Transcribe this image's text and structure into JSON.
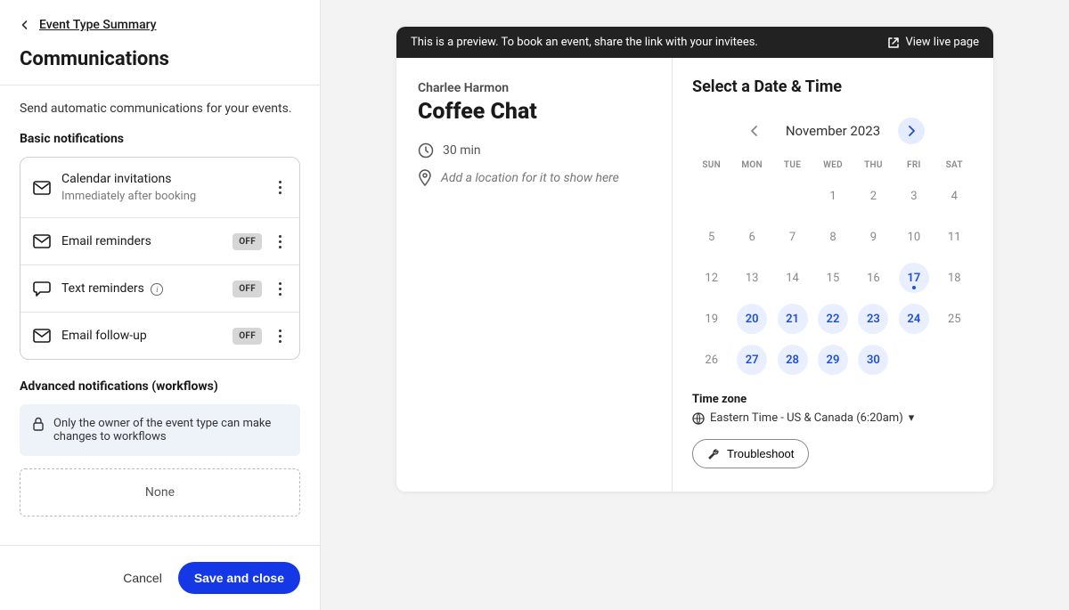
{
  "left": {
    "back_link": "Event Type Summary",
    "title": "Communications",
    "description": "Send automatic communications for your events.",
    "basic_title": "Basic notifications",
    "rows": {
      "calendar_invites": "Calendar invitations",
      "calendar_invites_sub": "Immediately after booking",
      "email_reminders": "Email reminders",
      "text_reminders": "Text reminders",
      "email_followup": "Email follow-up"
    },
    "off_badge": "OFF",
    "advanced_title": "Advanced notifications (workflows)",
    "advanced_banner": "Only the owner of the event type can make changes to workflows",
    "empty": "None",
    "cancel": "Cancel",
    "save": "Save and close"
  },
  "preview": {
    "banner_text": "This is a preview. To book an event, share the link with your invitees.",
    "view_live": "View live page",
    "host": "Charlee Harmon",
    "event_title": "Coffee Chat",
    "duration": "30 min",
    "location_placeholder": "Add a location for it to show here",
    "select_title": "Select a Date & Time",
    "month": "November 2023",
    "dow": [
      "SUN",
      "MON",
      "TUE",
      "WED",
      "THU",
      "FRI",
      "SAT"
    ],
    "days": [
      {
        "n": "",
        "t": "blank"
      },
      {
        "n": "",
        "t": "blank"
      },
      {
        "n": "",
        "t": "blank"
      },
      {
        "n": "1",
        "t": "off"
      },
      {
        "n": "2",
        "t": "off"
      },
      {
        "n": "3",
        "t": "off"
      },
      {
        "n": "4",
        "t": "off"
      },
      {
        "n": "5",
        "t": "off"
      },
      {
        "n": "6",
        "t": "off"
      },
      {
        "n": "7",
        "t": "off"
      },
      {
        "n": "8",
        "t": "off"
      },
      {
        "n": "9",
        "t": "off"
      },
      {
        "n": "10",
        "t": "off"
      },
      {
        "n": "11",
        "t": "off"
      },
      {
        "n": "12",
        "t": "off"
      },
      {
        "n": "13",
        "t": "off"
      },
      {
        "n": "14",
        "t": "off"
      },
      {
        "n": "15",
        "t": "off"
      },
      {
        "n": "16",
        "t": "off"
      },
      {
        "n": "17",
        "t": "avail today"
      },
      {
        "n": "18",
        "t": "off"
      },
      {
        "n": "19",
        "t": "off"
      },
      {
        "n": "20",
        "t": "avail"
      },
      {
        "n": "21",
        "t": "avail"
      },
      {
        "n": "22",
        "t": "avail"
      },
      {
        "n": "23",
        "t": "avail"
      },
      {
        "n": "24",
        "t": "avail"
      },
      {
        "n": "25",
        "t": "off"
      },
      {
        "n": "26",
        "t": "off"
      },
      {
        "n": "27",
        "t": "avail"
      },
      {
        "n": "28",
        "t": "avail"
      },
      {
        "n": "29",
        "t": "avail"
      },
      {
        "n": "30",
        "t": "avail"
      }
    ],
    "tz_label": "Time zone",
    "tz_value": "Eastern Time - US & Canada (6:20am)",
    "troubleshoot": "Troubleshoot"
  }
}
